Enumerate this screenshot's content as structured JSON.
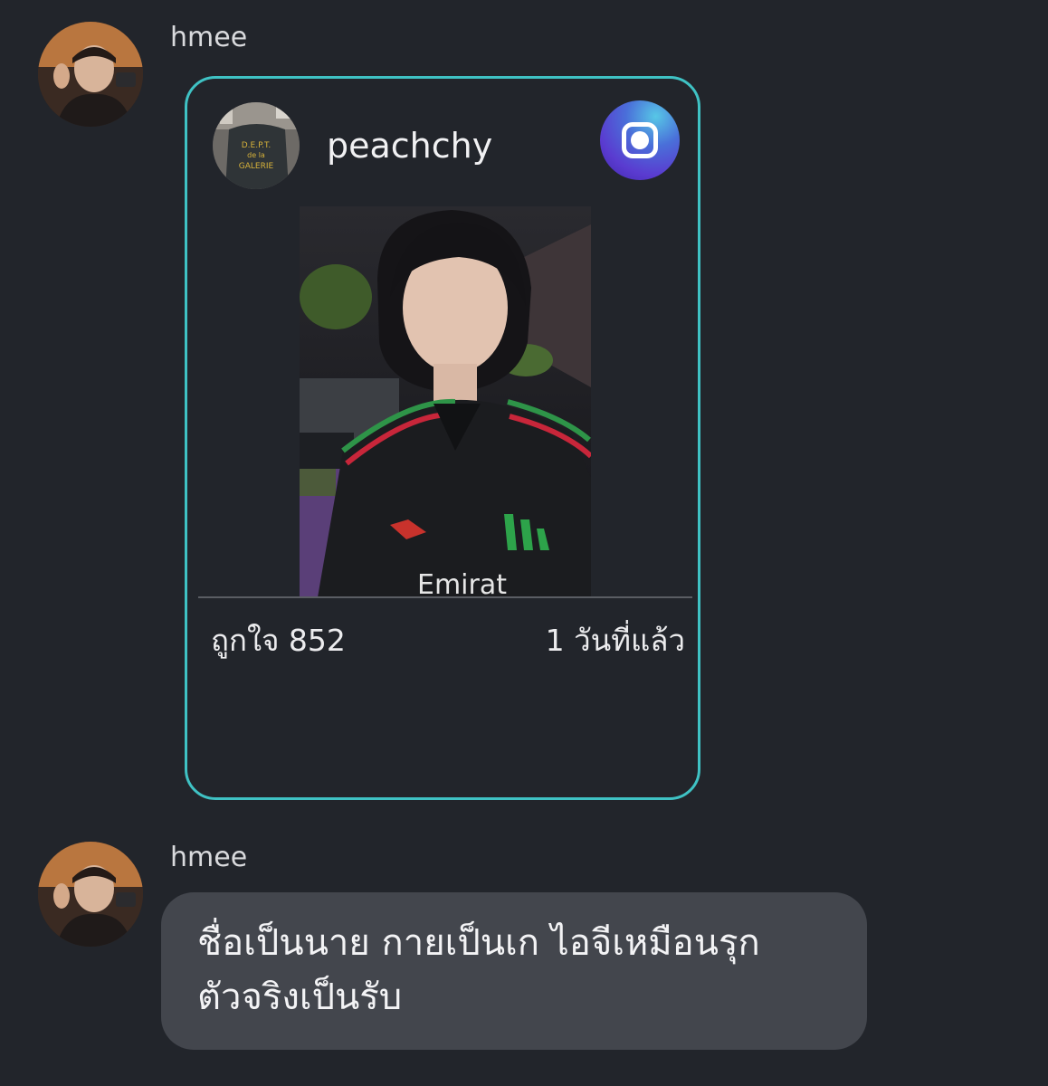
{
  "messages": [
    {
      "sender": "hmee",
      "avatar": "sender-avatar-photo",
      "type": "shared_post",
      "post": {
        "username": "peachchy",
        "avatar": "poster-avatar-photo",
        "platform_icon": "instagram-icon",
        "image": "post-photo",
        "likes_label": "ถูกใจ 852",
        "time_label": "1 วันที่แล้ว",
        "accent_color": "#3fc2c4"
      }
    },
    {
      "sender": "hmee",
      "avatar": "sender-avatar-photo",
      "type": "text",
      "text": "ชื่อเป็นนาย กายเป็นเก ไอจีเหมือนรุก\nตัวจริงเป็นรับ"
    }
  ],
  "colors": {
    "background": "#22252b",
    "bubble": "#43464d",
    "card_border": "#3fc2c4"
  }
}
